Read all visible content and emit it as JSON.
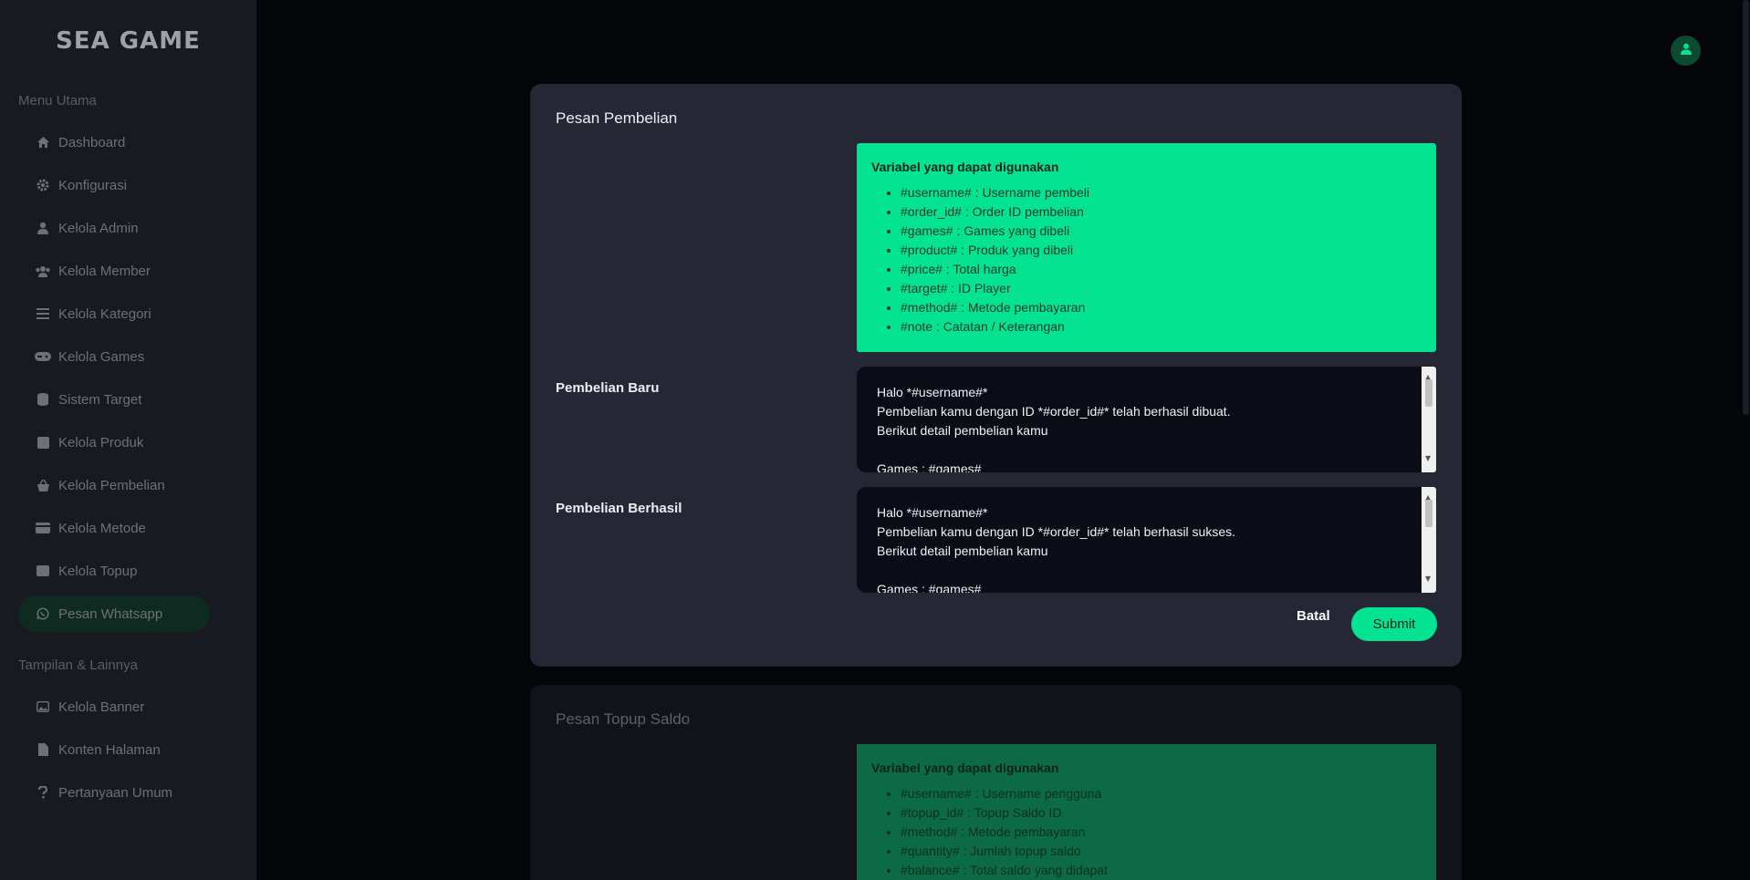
{
  "brand": {
    "name": "SEA GAME"
  },
  "sidebar": {
    "section_main": "Menu Utama",
    "section_other": "Tampilan & Lainnya",
    "items": [
      {
        "label": "Dashboard",
        "icon": "home-icon"
      },
      {
        "label": "Konfigurasi",
        "icon": "gear-icon"
      },
      {
        "label": "Kelola Admin",
        "icon": "user-icon"
      },
      {
        "label": "Kelola Member",
        "icon": "users-icon"
      },
      {
        "label": "Kelola Kategori",
        "icon": "list-icon"
      },
      {
        "label": "Kelola Games",
        "icon": "gamepad-icon"
      },
      {
        "label": "Sistem Target",
        "icon": "database-icon"
      },
      {
        "label": "Kelola Produk",
        "icon": "box-icon"
      },
      {
        "label": "Kelola Pembelian",
        "icon": "basket-icon"
      },
      {
        "label": "Kelola Metode",
        "icon": "card-icon"
      },
      {
        "label": "Kelola Topup",
        "icon": "wallet-icon"
      },
      {
        "label": "Pesan Whatsapp",
        "icon": "whatsapp-icon",
        "active": true
      }
    ],
    "other_items": [
      {
        "label": "Kelola Banner",
        "icon": "image-icon"
      },
      {
        "label": "Konten Halaman",
        "icon": "file-icon"
      },
      {
        "label": "Pertanyaan Umum",
        "icon": "question-icon"
      }
    ]
  },
  "purchase_card": {
    "title": "Pesan Pembelian",
    "variables_title": "Variabel yang dapat digunakan",
    "variables": [
      "#username# : Username pembeli",
      "#order_id# : Order ID pembelian",
      "#games# : Games yang dibeli",
      "#product# : Produk yang dibeli",
      "#price# : Total harga",
      "#target# : ID Player",
      "#method# : Metode pembayaran",
      "#note : Catatan / Keterangan"
    ],
    "new_label": "Pembelian Baru",
    "new_lines": [
      "Halo *#username#*",
      "Pembelian kamu dengan ID *#order_id#* telah berhasil dibuat.",
      "Berikut detail pembelian kamu",
      "",
      "Games : #games#"
    ],
    "success_label": "Pembelian Berhasil",
    "success_lines": [
      "Halo *#username#*",
      "Pembelian kamu dengan ID *#order_id#* telah berhasil sukses.",
      "Berikut detail pembelian kamu",
      "",
      "Games : #games#"
    ],
    "cancel_label": "Batal",
    "submit_label": "Submit"
  },
  "topup_card": {
    "title": "Pesan Topup Saldo",
    "variables_title": "Variabel yang dapat digunakan",
    "variables": [
      "#username# : Username pengguna",
      "#topup_id# : Topup Saldo ID",
      "#method# : Metode pembayaran",
      "#quantity# : Jumlah topup saldo",
      "#balance# : Total saldo yang didapat"
    ]
  },
  "colors": {
    "accent": "#04e391",
    "card": "#252834",
    "sidebar": "#181a21"
  }
}
